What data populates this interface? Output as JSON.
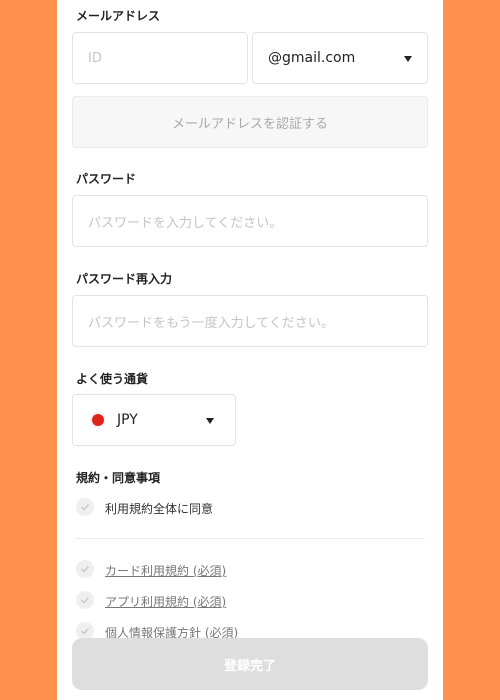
{
  "email": {
    "label": "メールアドレス",
    "id_placeholder": "ID",
    "domain_value": "@gmail.com",
    "verify_button": "メールアドレスを認証する"
  },
  "password": {
    "label": "パスワード",
    "placeholder": "パスワードを入力してください。"
  },
  "password_confirm": {
    "label": "パスワード再入力",
    "placeholder": "パスワードをもう一度入力してください。"
  },
  "currency": {
    "label": "よく使う通貨",
    "value": "JPY",
    "flag_color": "#E0231B"
  },
  "terms": {
    "label": "規約・同意事項",
    "agree_all": "利用規約全体に同意",
    "items": [
      {
        "label": "カード利用規約 (必須)"
      },
      {
        "label": "アプリ利用規約 (必須)"
      },
      {
        "label": "個人情報保護方針 (必須)"
      }
    ]
  },
  "submit": {
    "label": "登録完了"
  },
  "colors": {
    "background": "#FF914D",
    "panel": "#FFFFFF",
    "disabled_button": "#DEDEDE"
  }
}
